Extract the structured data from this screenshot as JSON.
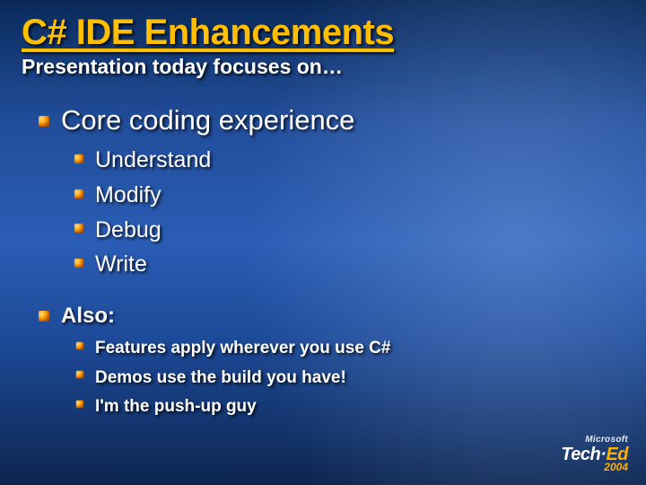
{
  "title": "C# IDE Enhancements",
  "subtitle": "Presentation today focuses on…",
  "section1": {
    "heading": "Core coding experience",
    "items": [
      "Understand",
      "Modify",
      "Debug",
      "Write"
    ]
  },
  "section2": {
    "heading": "Also:",
    "items": [
      "Features apply wherever you use C#",
      "Demos use the build you have!",
      "I'm the push-up guy"
    ]
  },
  "logo": {
    "vendor": "Microsoft",
    "brand_a": "Tech·",
    "brand_b": "Ed",
    "year": "2004"
  }
}
